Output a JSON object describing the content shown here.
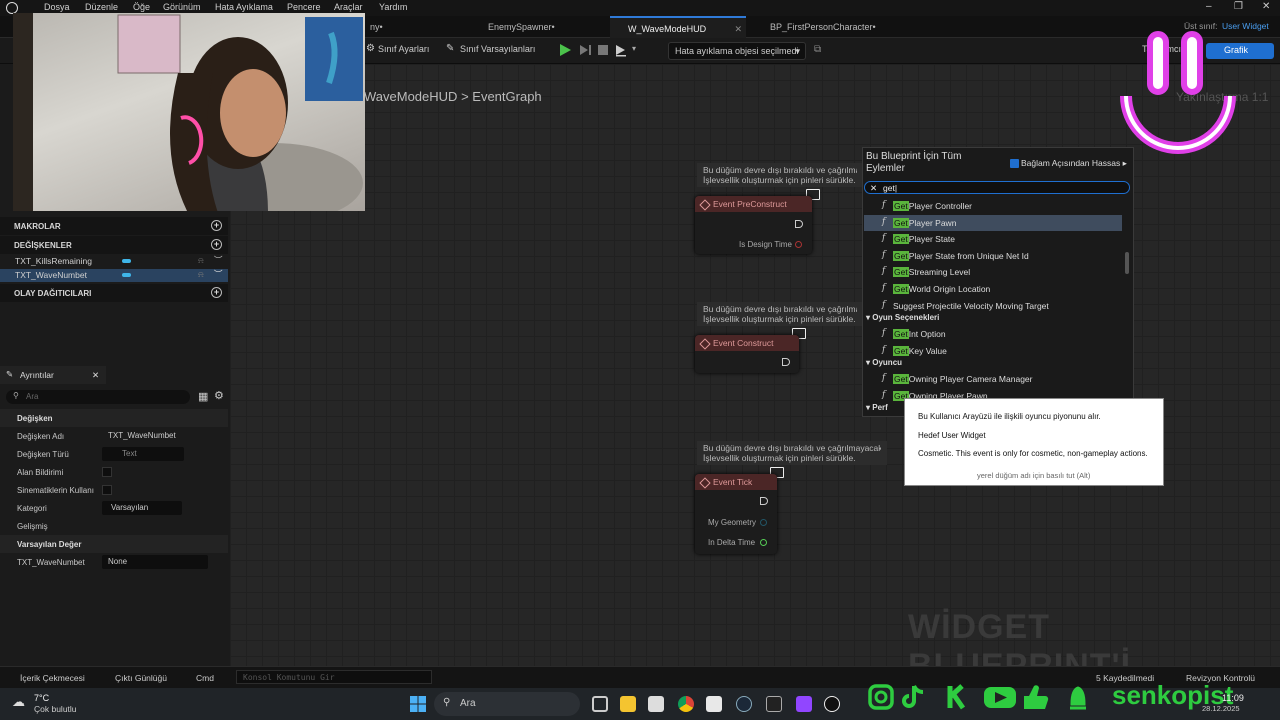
{
  "menu": [
    "Dosya",
    "Düzenle",
    "Öğe",
    "Görünüm",
    "Hata Ayıklama",
    "Pencere",
    "Araçlar",
    "Yardım"
  ],
  "tabs": [
    {
      "label": "ny•"
    },
    {
      "label": "EnemySpawner•"
    },
    {
      "label": "W_WaveModeHUD",
      "active": true
    },
    {
      "label": "BP_FirstPersonCharacter•"
    }
  ],
  "top_right": {
    "parent_label": "Üst sınıf:",
    "parent_value": "User Widget"
  },
  "toolbar": {
    "class_settings": "Sınıf Ayarları",
    "class_defaults": "Sınıf Varsayılanları",
    "debug_select": "Hata ayıklama objesi seçilmedi",
    "designer": "Tasarımcı",
    "graph": "Grafik"
  },
  "graph": {
    "breadcrumb_root": "WaveModeHUD",
    "breadcrumb_sep": ">",
    "breadcrumb_page": "EventGraph",
    "zoom": "Yakınlaştırma 1:1",
    "watermark": "WİDGET BLUEPRINT'İ"
  },
  "sidebar": {
    "macros": "MAKROLAR",
    "variables": "DEĞİŞKENLER",
    "variable_items": [
      "TXT_KillsRemaining",
      "TXT_WaveNumbet"
    ],
    "dispatchers": "OLAY DAĞITICILARI"
  },
  "details": {
    "tab": "Ayrıntılar",
    "search_placeholder": "Ara",
    "section_variable": "Değişken",
    "var_name_label": "Değişken Adı",
    "var_name_value": "TXT_WaveNumbet",
    "var_type_label": "Değişken Türü",
    "var_type_value": "Text",
    "field_notify_label": "Alan Bildirimi",
    "cinematic_label": "Sinematiklerin Kullanı",
    "category_label": "Kategori",
    "category_value": "Varsayılan",
    "advanced": "Gelişmiş",
    "section_default": "Varsayılan Değer",
    "default_name": "TXT_WaveNumbet",
    "default_value": "None"
  },
  "comments": {
    "line1": "Bu düğüm devre dışı bırakıldı ve çağrılmayacak.",
    "line2": "İşlevsellik oluşturmak için pinleri sürükle."
  },
  "nodes": {
    "preconstruct": "Event PreConstruct",
    "is_design_time": "Is Design Time",
    "construct": "Event Construct",
    "tick": "Event Tick",
    "my_geometry": "My Geometry",
    "in_delta_time": "In Delta Time"
  },
  "action_menu": {
    "title": "Bu Blueprint İçin Tüm Eylemler",
    "context": "Bağlam Açısından Hassas",
    "search_value": "get",
    "items": [
      {
        "hl": "Get",
        "rest": "Player Controller"
      },
      {
        "hl": "Get",
        "rest": "Player Pawn",
        "selected": true
      },
      {
        "hl": "Get",
        "rest": "Player State"
      },
      {
        "hl": "Get",
        "rest": "Player State from Unique Net Id"
      },
      {
        "hl": "Get",
        "rest": "Streaming Level"
      },
      {
        "hl": "Get",
        "rest": "World Origin Location"
      },
      {
        "hl": "",
        "rest": "Suggest Projectile Velocity Moving Target"
      }
    ],
    "cat_game_options": "Oyun Seçenekleri",
    "items2": [
      {
        "hl": "Get",
        "rest": "Int Option"
      },
      {
        "hl": "Get",
        "rest": "Key Value"
      }
    ],
    "cat_player": "Oyuncu",
    "items3": [
      {
        "hl": "Get",
        "rest": "Owning Player Camera Manager"
      },
      {
        "hl": "Get",
        "rest": "Owning Player Pawn"
      }
    ],
    "cat_perf": "Perf"
  },
  "tooltip": {
    "line1": "Bu Kullanıcı Arayüzü ile ilişkili oyuncu piyonunu alır.",
    "line2": "Hedef User Widget",
    "line3": "Cosmetic. This event is only for cosmetic, non-gameplay actions.",
    "hint": "yerel düğüm adı için basılı tut (Alt)"
  },
  "statusbar": {
    "content_drawer": "İçerik Çekmecesi",
    "output_log": "Çıktı Günlüğü",
    "cmd": "Cmd",
    "console_placeholder": "Konsol Komutunu Gir",
    "saved": "5 Kaydedilmedi",
    "revision": "Revizyon Kontrolü"
  },
  "taskbar": {
    "temp": "7°C",
    "weather": "Çok bulutlu",
    "search": "Ara",
    "time": "11:09",
    "date": "28.12.2025"
  },
  "overlay": {
    "channel": "senkopist"
  },
  "colors": {
    "accent": "#1f6fd0",
    "highlight": "#5ab53c",
    "overlay_pink": "#e040e8",
    "overlay_green": "#2ecc40"
  }
}
